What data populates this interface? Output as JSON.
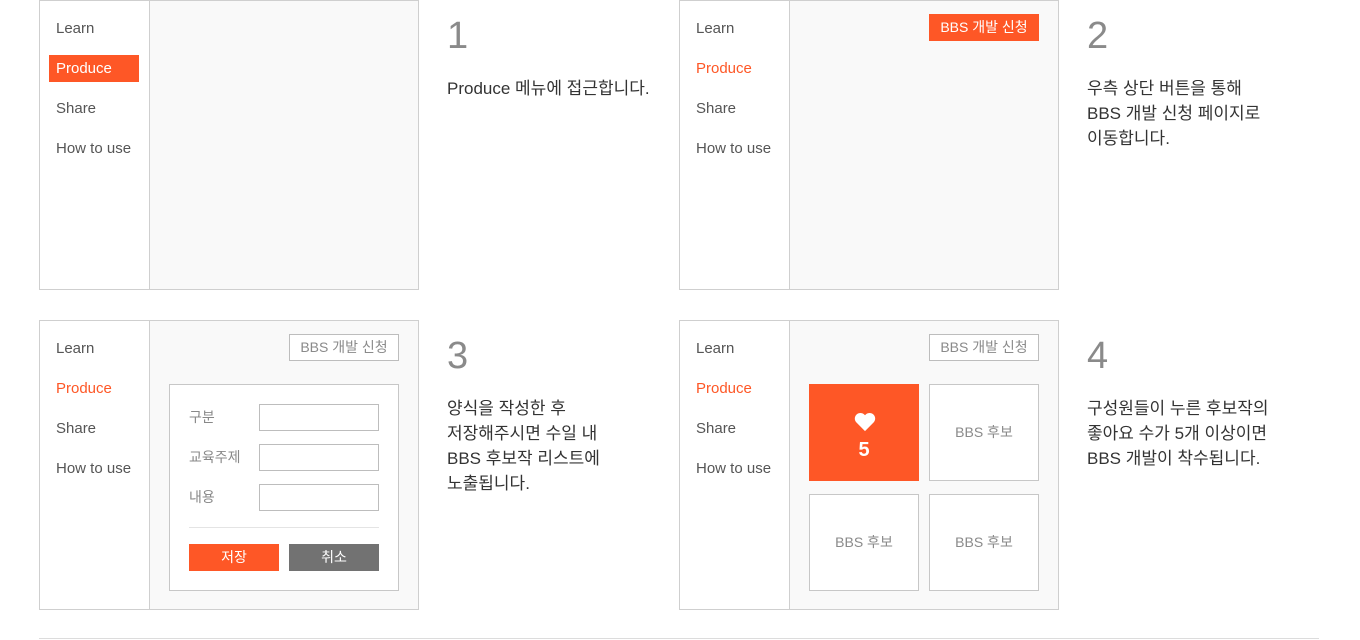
{
  "sidebar": {
    "items": [
      {
        "label": "Learn"
      },
      {
        "label": "Produce"
      },
      {
        "label": "Share"
      },
      {
        "label": "How to use"
      }
    ]
  },
  "bbs_button_label": "BBS 개발 신청",
  "steps": [
    {
      "number": "1",
      "lines": [
        "Produce 메뉴에 접근합니다."
      ]
    },
    {
      "number": "2",
      "lines": [
        "우측 상단 버튼을 통해",
        "BBS 개발 신청 페이지로",
        "이동합니다."
      ]
    },
    {
      "number": "3",
      "lines": [
        "양식을 작성한 후",
        "저장해주시면 수일 내",
        "BBS 후보작 리스트에",
        "노출됩니다."
      ]
    },
    {
      "number": "4",
      "lines": [
        "구성원들이 누른 후보작의",
        "좋아요 수가 5개 이상이면",
        "BBS 개발이 착수됩니다."
      ]
    }
  ],
  "form": {
    "fields": [
      {
        "label": "구분",
        "value": ""
      },
      {
        "label": "교육주제",
        "value": ""
      },
      {
        "label": "내용",
        "value": ""
      }
    ],
    "save_label": "저장",
    "cancel_label": "취소"
  },
  "candidates": {
    "liked_count": "5",
    "label": "BBS 후보"
  },
  "colors": {
    "accent": "#fe5726",
    "cancel": "#727272",
    "border": "#cfcfcf",
    "panel_bg": "#f9f9f9"
  },
  "icons": [
    "heart-icon"
  ]
}
